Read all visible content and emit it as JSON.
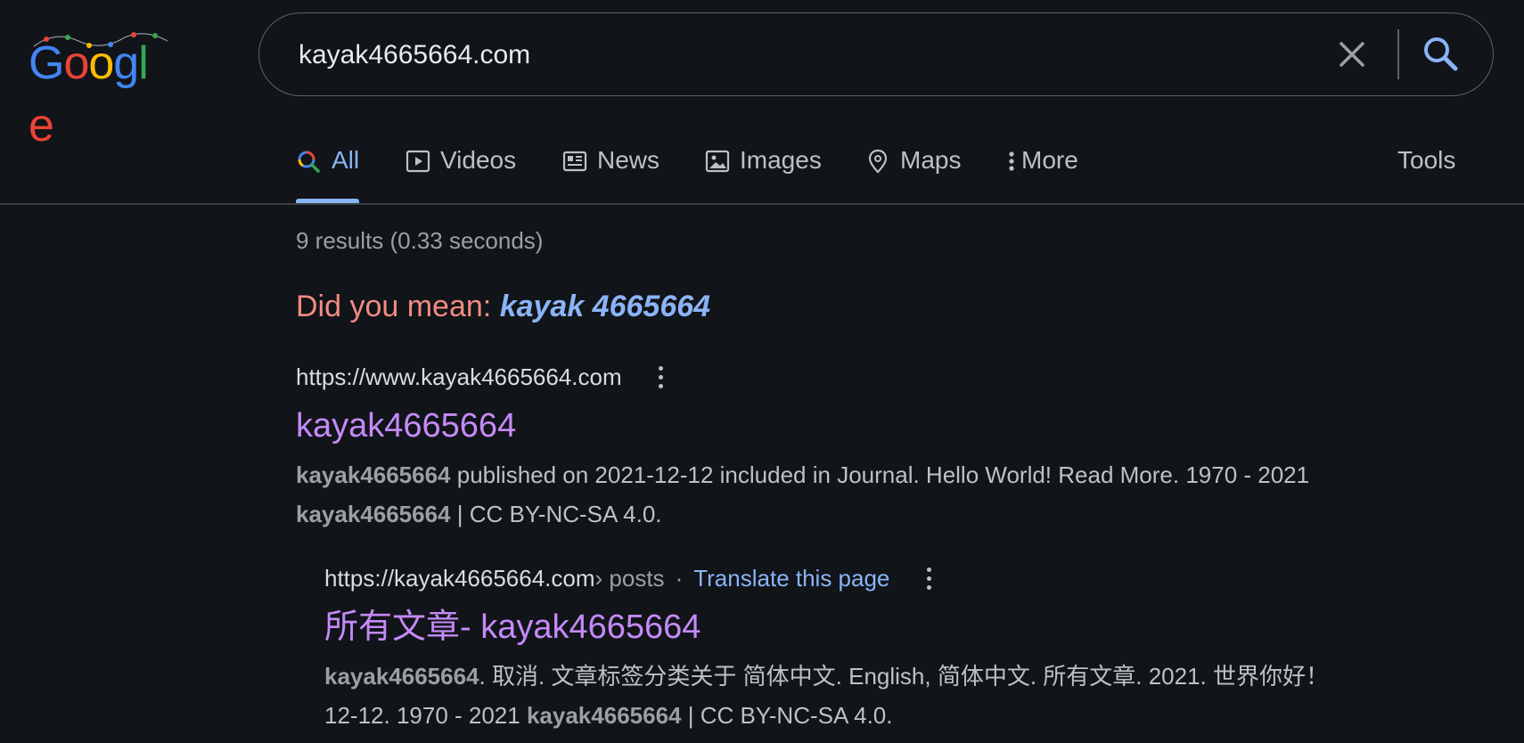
{
  "search": {
    "query": "kayak4665664.com",
    "placeholder": ""
  },
  "logo": {
    "letters": [
      "G",
      "o",
      "o",
      "g",
      "l",
      "e"
    ],
    "colors": [
      "#4285f4",
      "#ea4335",
      "#fbbc05",
      "#4285f4",
      "#34a853",
      "#ea4335"
    ]
  },
  "tabs": [
    {
      "label": "All",
      "icon": "search-icon",
      "active": true
    },
    {
      "label": "Videos",
      "icon": "play-icon",
      "active": false
    },
    {
      "label": "News",
      "icon": "news-icon",
      "active": false
    },
    {
      "label": "Images",
      "icon": "image-icon",
      "active": false
    },
    {
      "label": "Maps",
      "icon": "map-pin-icon",
      "active": false
    },
    {
      "label": "More",
      "icon": "more-vert-icon",
      "active": false
    }
  ],
  "tools_label": "Tools",
  "result_stats": "9 results (0.33 seconds)",
  "spell": {
    "prefix": "Did you mean:",
    "suggestion": "kayak 4665664"
  },
  "results": [
    {
      "url": "https://www.kayak4665664.com",
      "title": "kayak4665664",
      "snippet_bold_1": "kayak4665664",
      "snippet_text_1": " published on 2021-12-12 included in Journal. Hello World! Read More. 1970 - 2021 ",
      "snippet_bold_2": "kayak4665664",
      "snippet_text_2": " | CC BY-NC-SA 4.0."
    },
    {
      "url": "https://kayak4665664.com",
      "breadcrumb": " › posts",
      "dot": "·",
      "translate": "Translate this page",
      "title": "所有文章- kayak4665664",
      "snippet_bold_1": "kayak4665664",
      "snippet_text_1": ". 取消. 文章标签分类关于 简体中文. English, 简体中文. 所有文章. 2021. 世界你好！  12-12. 1970 - 2021 ",
      "snippet_bold_2": "kayak4665664",
      "snippet_text_2": " | CC BY-NC-SA 4.0."
    }
  ],
  "colors": {
    "background": "#111418",
    "link_visited": "#c58af9",
    "accent": "#8ab4f8",
    "spell_prefix": "#f28b82"
  }
}
